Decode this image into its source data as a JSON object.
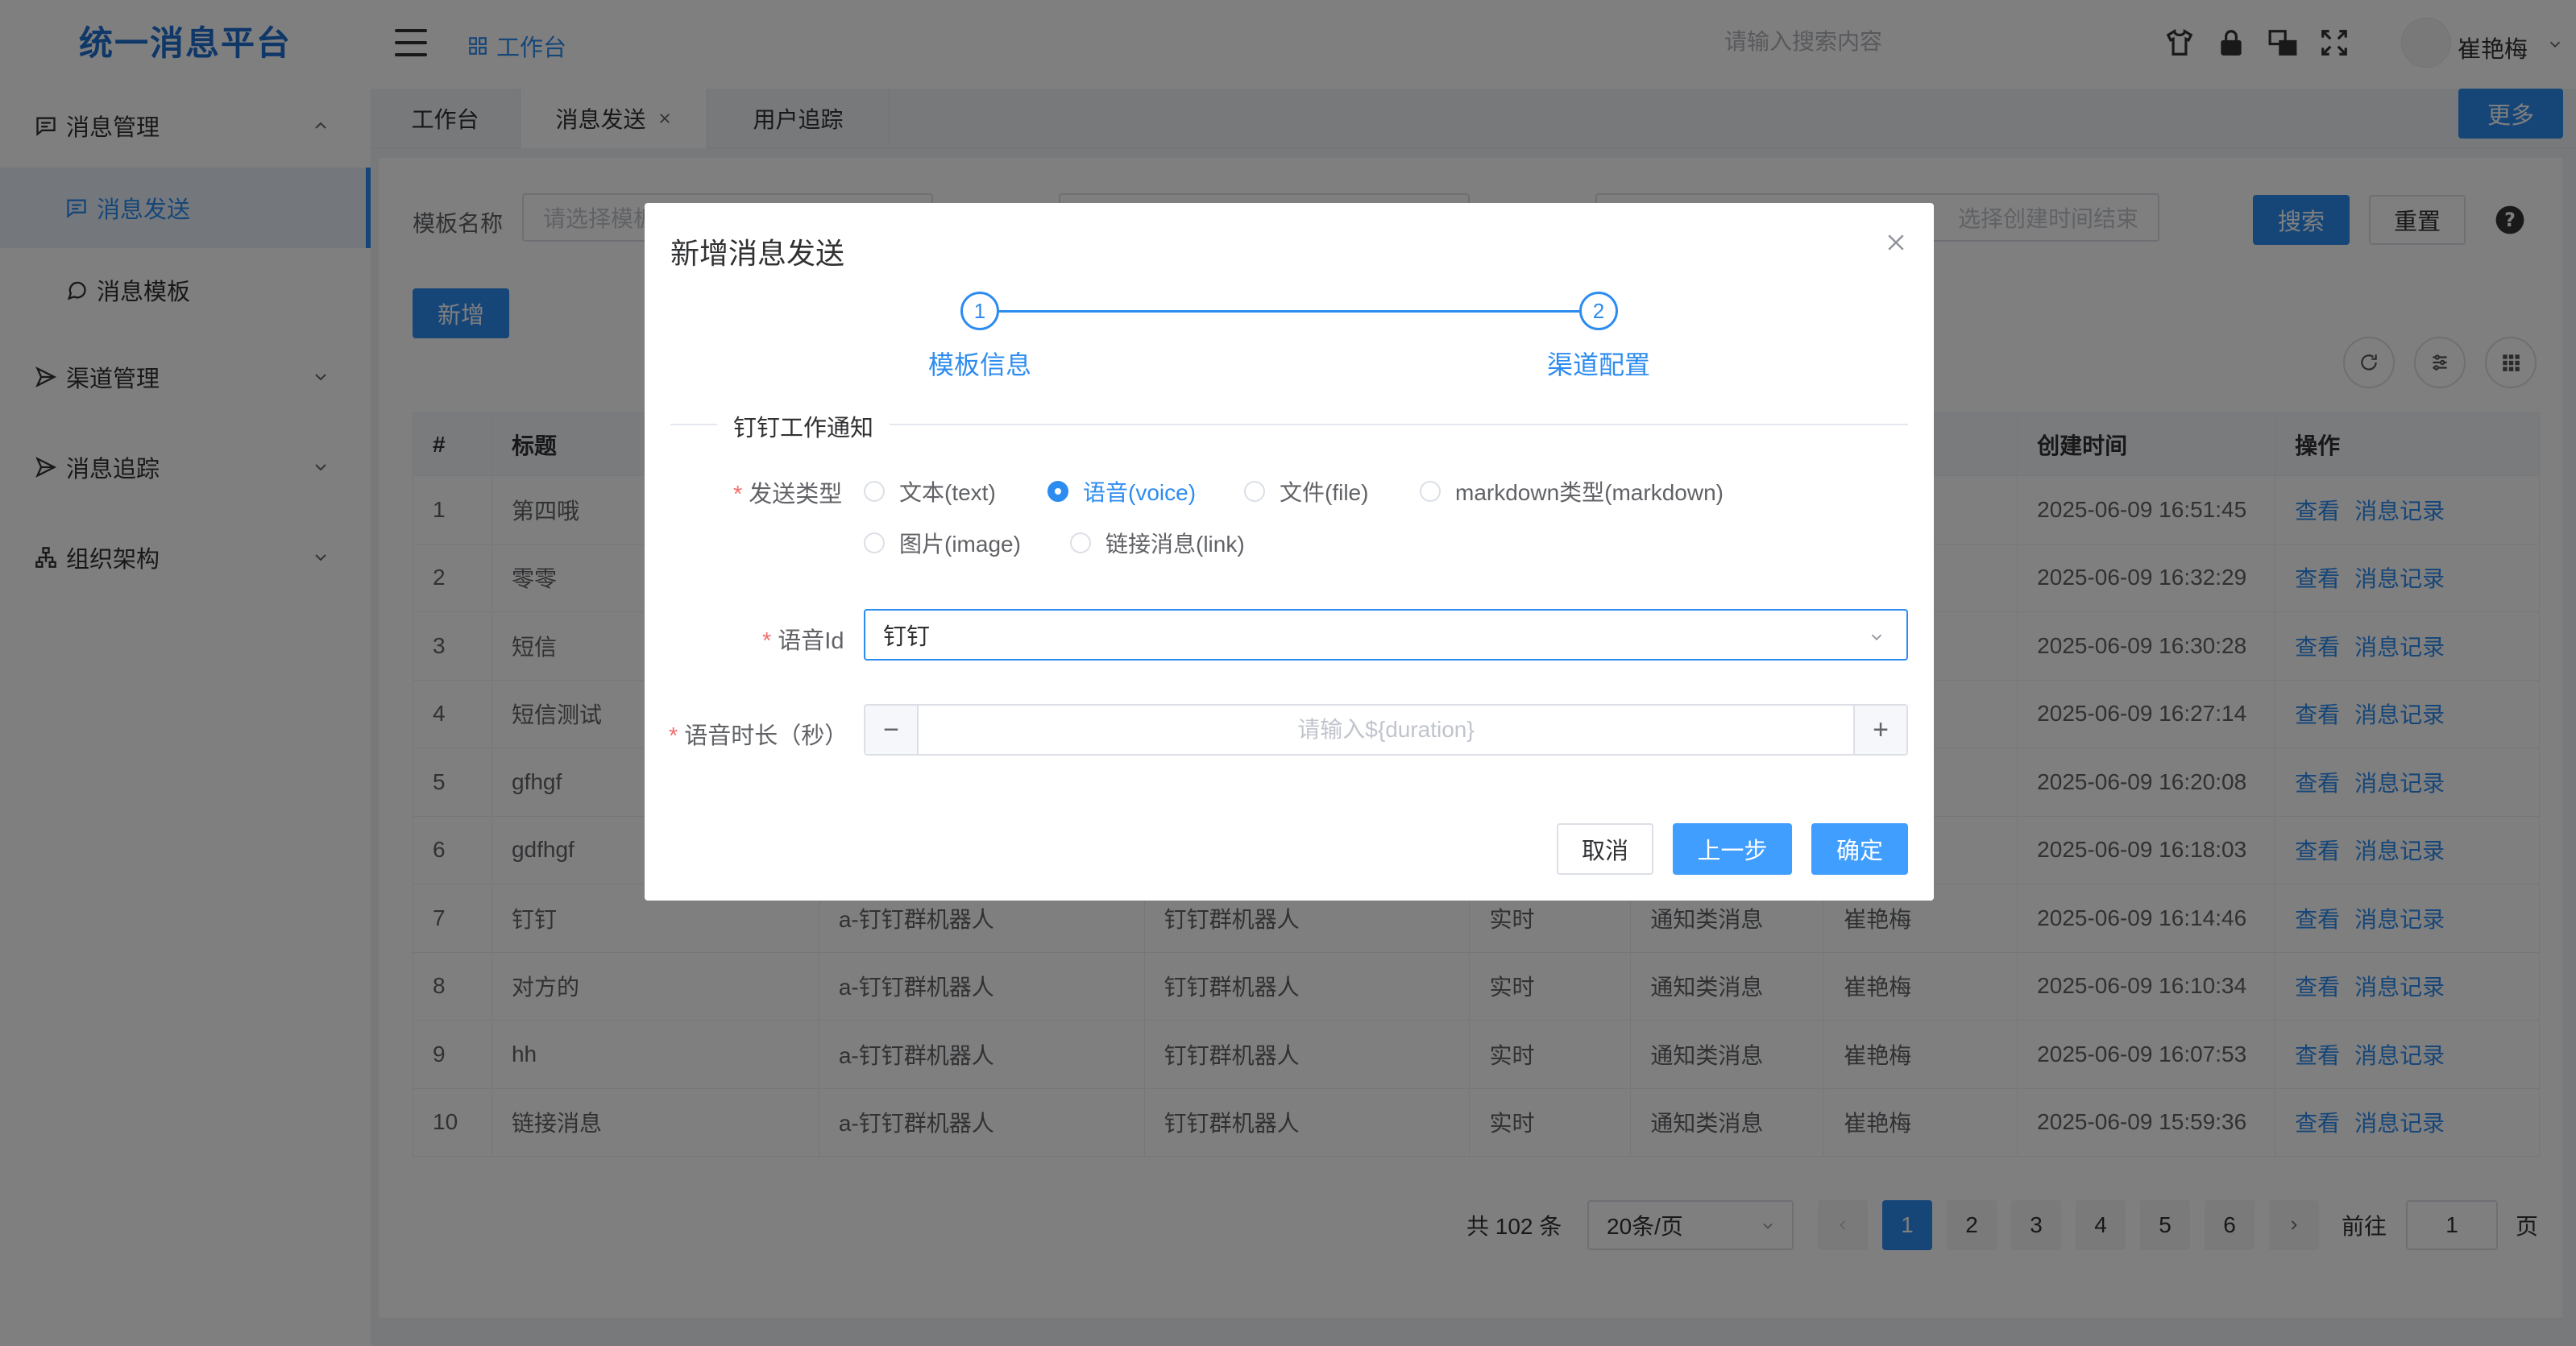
{
  "app": {
    "title": "统一消息平台"
  },
  "sidebar": {
    "menus": [
      {
        "label": "消息管理",
        "icon": "message-square-icon",
        "expanded": true,
        "children": [
          {
            "label": "消息发送",
            "icon": "message-square-icon",
            "active": true
          },
          {
            "label": "消息模板",
            "icon": "message-circle-icon",
            "active": false
          }
        ]
      },
      {
        "label": "渠道管理",
        "icon": "send-icon"
      },
      {
        "label": "消息追踪",
        "icon": "send-icon"
      },
      {
        "label": "组织架构",
        "icon": "org-chart-icon"
      }
    ]
  },
  "header": {
    "workspace_label": "工作台",
    "search_placeholder": "请输入搜索内容",
    "icons": [
      "shirt-icon",
      "lock-icon",
      "translate-icon",
      "fullscreen-icon"
    ],
    "username": "崔艳梅"
  },
  "tabs": [
    {
      "label": "工作台",
      "active": false,
      "closable": false
    },
    {
      "label": "消息发送",
      "active": true,
      "closable": true
    },
    {
      "label": "用户追踪",
      "active": false,
      "closable": false
    }
  ],
  "more_label": "更多",
  "filters": {
    "template_name_label": "模板名称",
    "template_name_placeholder": "请选择模板",
    "end_time_placeholder": "选择创建时间结束",
    "search_label": "搜索",
    "reset_label": "重置"
  },
  "add_label": "新增",
  "table": {
    "columns": [
      "#",
      "标题",
      "",
      "",
      "",
      "",
      "",
      "创建时间",
      "操作"
    ],
    "rows": [
      {
        "no": "1",
        "title": "第四哦",
        "c3": "",
        "c4": "",
        "c5": "",
        "c6": "",
        "c7": "",
        "time": "2025-06-09 16:51:45"
      },
      {
        "no": "2",
        "title": "零零",
        "c3": "",
        "c4": "",
        "c5": "",
        "c6": "",
        "c7": "",
        "time": "2025-06-09 16:32:29"
      },
      {
        "no": "3",
        "title": "短信",
        "c3": "",
        "c4": "",
        "c5": "",
        "c6": "",
        "c7": "",
        "time": "2025-06-09 16:30:28"
      },
      {
        "no": "4",
        "title": "短信测试",
        "c3": "",
        "c4": "",
        "c5": "",
        "c6": "",
        "c7": "",
        "time": "2025-06-09 16:27:14"
      },
      {
        "no": "5",
        "title": "gfhgf",
        "c3": "",
        "c4": "",
        "c5": "",
        "c6": "",
        "c7": "",
        "time": "2025-06-09 16:20:08"
      },
      {
        "no": "6",
        "title": "gdfhgf",
        "c3": "",
        "c4": "",
        "c5": "",
        "c6": "",
        "c7": "",
        "time": "2025-06-09 16:18:03"
      },
      {
        "no": "7",
        "title": "钉钉",
        "c3": "a-钉钉群机器人",
        "c4": "钉钉群机器人",
        "c5": "实时",
        "c6": "通知类消息",
        "c7": "崔艳梅",
        "time": "2025-06-09 16:14:46"
      },
      {
        "no": "8",
        "title": "对方的",
        "c3": "a-钉钉群机器人",
        "c4": "钉钉群机器人",
        "c5": "实时",
        "c6": "通知类消息",
        "c7": "崔艳梅",
        "time": "2025-06-09 16:10:34"
      },
      {
        "no": "9",
        "title": "hh",
        "c3": "a-钉钉群机器人",
        "c4": "钉钉群机器人",
        "c5": "实时",
        "c6": "通知类消息",
        "c7": "崔艳梅",
        "time": "2025-06-09 16:07:53"
      },
      {
        "no": "10",
        "title": "链接消息",
        "c3": "a-钉钉群机器人",
        "c4": "钉钉群机器人",
        "c5": "实时",
        "c6": "通知类消息",
        "c7": "崔艳梅",
        "time": "2025-06-09 15:59:36"
      }
    ],
    "action_view": "查看",
    "action_records": "消息记录"
  },
  "pagination": {
    "total_text": "共 102 条",
    "page_size": "20条/页",
    "pages": [
      "1",
      "2",
      "3",
      "4",
      "5",
      "6"
    ],
    "current": "1",
    "goto_prefix": "前往",
    "goto_value": "1",
    "goto_suffix": "页"
  },
  "modal": {
    "title": "新增消息发送",
    "steps": [
      {
        "number": "1",
        "label": "模板信息"
      },
      {
        "number": "2",
        "label": "渠道配置"
      }
    ],
    "section_title": "钉钉工作通知",
    "send_type_label": "发送类型",
    "send_types": [
      {
        "label": "文本(text)",
        "checked": false
      },
      {
        "label": "语音(voice)",
        "checked": true
      },
      {
        "label": "文件(file)",
        "checked": false
      },
      {
        "label": "markdown类型(markdown)",
        "checked": false
      },
      {
        "label": "图片(image)",
        "checked": false
      },
      {
        "label": "链接消息(link)",
        "checked": false
      }
    ],
    "voice_id_label": "语音Id",
    "voice_id_value": "钉钉",
    "duration_label": "语音时长（秒）",
    "duration_placeholder": "请输入${duration}",
    "cancel_label": "取消",
    "prev_label": "上一步",
    "confirm_label": "确定"
  },
  "colors": {
    "primary": "#2d8cf0",
    "overlay": "rgba(0,0,0,0.5)",
    "required": "#f56c6c"
  }
}
